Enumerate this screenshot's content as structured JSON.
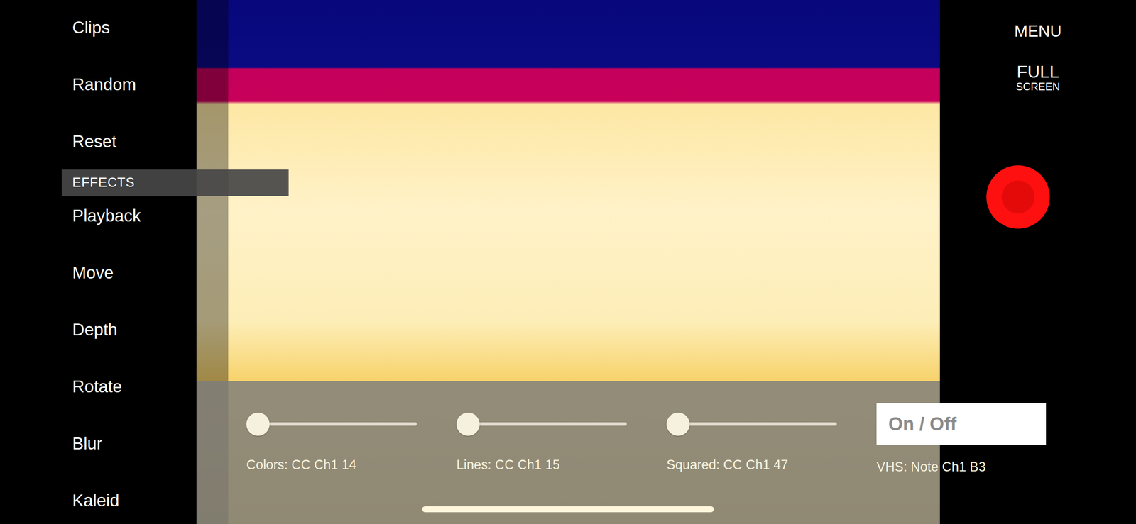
{
  "sidebar": {
    "items": [
      {
        "label": "Clips",
        "kind": "item"
      },
      {
        "label": "Random",
        "kind": "item"
      },
      {
        "label": "Reset",
        "kind": "item"
      },
      {
        "label": "EFFECTS",
        "kind": "header"
      },
      {
        "label": "Playback",
        "kind": "item"
      },
      {
        "label": "Move",
        "kind": "item"
      },
      {
        "label": "Depth",
        "kind": "item"
      },
      {
        "label": "Rotate",
        "kind": "item"
      },
      {
        "label": "Blur",
        "kind": "item"
      },
      {
        "label": "Kaleid",
        "kind": "item"
      }
    ]
  },
  "top_right": {
    "menu": "MENU",
    "fullscreen": {
      "line1": "FULL",
      "line2": "SCREEN"
    }
  },
  "controls": [
    {
      "kind": "slider",
      "label": "Colors: CC Ch1 14",
      "level": 0
    },
    {
      "kind": "slider",
      "label": "Lines: CC Ch1 15",
      "level": 0
    },
    {
      "kind": "slider",
      "label": "Squared: CC Ch1 47",
      "level": 0
    },
    {
      "kind": "toggle",
      "button": "On / Off",
      "label": "VHS: Note Ch1 B3"
    }
  ]
}
